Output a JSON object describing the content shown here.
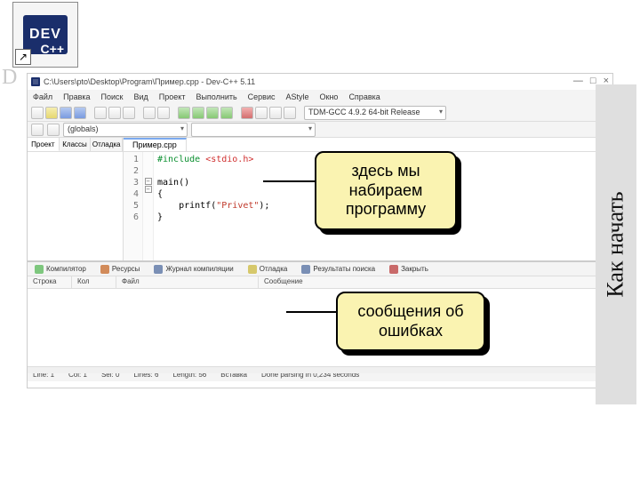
{
  "icon": {
    "dev": "DEV",
    "cpp": "C++",
    "shortcut": "↗"
  },
  "faded_d": "D",
  "window": {
    "title": "C:\\Users\\pto\\Desktop\\Program\\Пример.cpp - Dev-C++ 5.11",
    "controls": {
      "min": "—",
      "max": "□",
      "close": "×"
    }
  },
  "menu": [
    "Файл",
    "Правка",
    "Поиск",
    "Вид",
    "Проект",
    "Выполнить",
    "Сервис",
    "AStyle",
    "Окно",
    "Справка"
  ],
  "toolbar2": {
    "globals": "(globals)"
  },
  "compiler": "TDM-GCC 4.9.2 64-bit Release",
  "side": {
    "tabs": [
      "Проект",
      "Классы",
      "Отладка"
    ]
  },
  "file_tab": "Пример.cpp",
  "code": {
    "line_nos": "1\n2\n3\n4\n5\n6",
    "l1a": "#include ",
    "l1b": "<stdio.h>",
    "l2": "",
    "l3a": "main",
    "l3b": "()",
    "l4a": "{",
    "l5a": "    printf(",
    "l5b": "\"Privet\"",
    "l5c": ");",
    "l6a": "}"
  },
  "bottom_tabs": [
    {
      "icon": "g",
      "label": "Компилятор"
    },
    {
      "icon": "r",
      "label": "Ресурсы"
    },
    {
      "icon": "b",
      "label": "Журнал компиляции"
    },
    {
      "icon": "y",
      "label": "Отладка"
    },
    {
      "icon": "b",
      "label": "Результаты поиска"
    },
    {
      "icon": "x",
      "label": "Закрыть"
    }
  ],
  "msg_headers": {
    "line": "Строка",
    "col": "Кол",
    "file": "Файл",
    "msg": "Сообщение"
  },
  "status": {
    "line": "Line: 1",
    "col": "Col: 1",
    "sel": "Sel: 0",
    "lines": "Lines: 6",
    "length": "Length: 56",
    "insert": "Вставка",
    "done": "Done parsing in 0,234 seconds"
  },
  "callouts": {
    "c1": "здесь мы набираем программу",
    "c2": "сообщения об ошибках"
  },
  "vtitle": "Как начать"
}
